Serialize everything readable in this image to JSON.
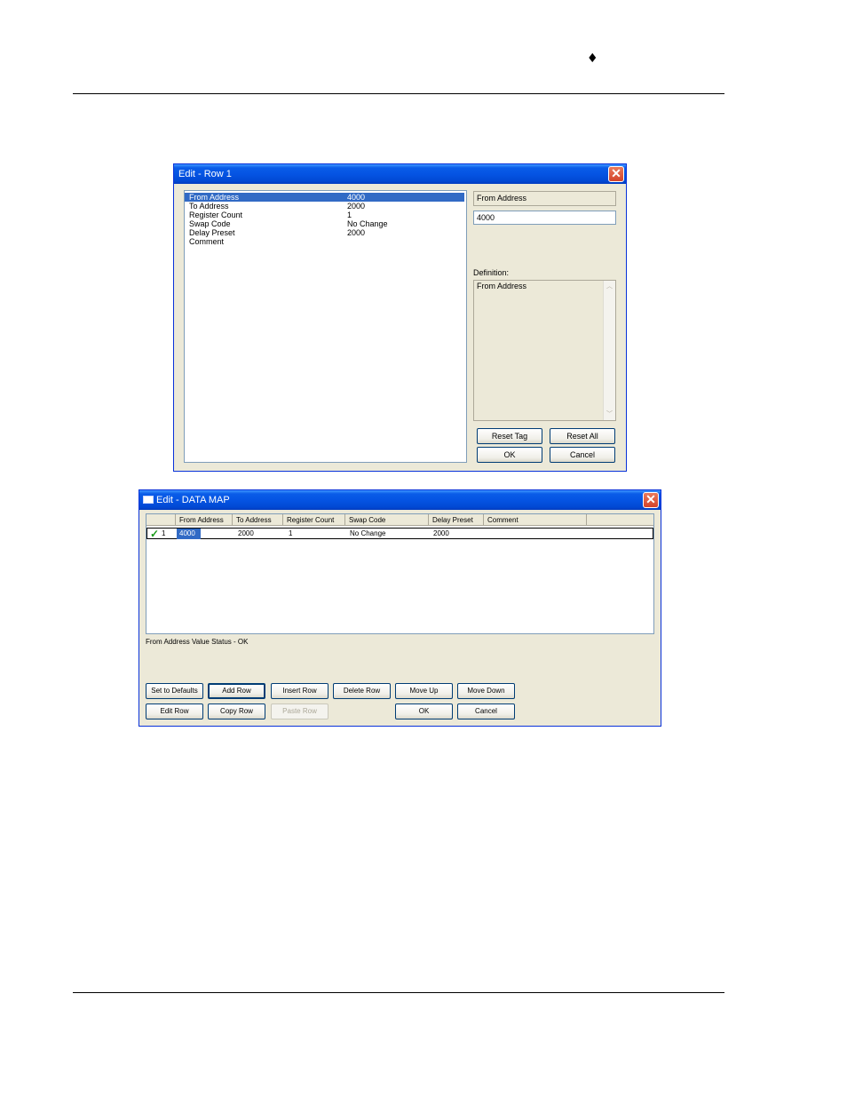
{
  "page": {
    "header_mark": "♦"
  },
  "edit_row_dialog": {
    "title": "Edit - Row 1",
    "properties": [
      {
        "name": "From Address",
        "value": "4000",
        "selected": true
      },
      {
        "name": "To Address",
        "value": "2000"
      },
      {
        "name": "Register Count",
        "value": "1"
      },
      {
        "name": "Swap Code",
        "value": "No Change"
      },
      {
        "name": "Delay Preset",
        "value": "2000"
      },
      {
        "name": "Comment",
        "value": ""
      }
    ],
    "selected_name": "From Address",
    "value_input": "4000",
    "definition_label": "Definition:",
    "definition_text": "From Address",
    "buttons": {
      "reset_tag": "Reset Tag",
      "reset_all": "Reset All",
      "ok": "OK",
      "cancel": "Cancel"
    }
  },
  "data_map_dialog": {
    "title": "Edit - DATA MAP",
    "columns": [
      "From Address",
      "To Address",
      "Register Count",
      "Swap Code",
      "Delay Preset",
      "Comment"
    ],
    "rows": [
      {
        "index": "1",
        "from": "4000",
        "to": "2000",
        "count": "1",
        "swap": "No Change",
        "delay": "2000",
        "comment": ""
      }
    ],
    "status": "From Address Value Status - OK",
    "buttons": {
      "set_defaults": "Set to Defaults",
      "add_row": "Add Row",
      "insert_row": "Insert Row",
      "delete_row": "Delete Row",
      "move_up": "Move Up",
      "move_down": "Move Down",
      "edit_row": "Edit Row",
      "copy_row": "Copy Row",
      "paste_row": "Paste Row",
      "ok": "OK",
      "cancel": "Cancel"
    }
  }
}
